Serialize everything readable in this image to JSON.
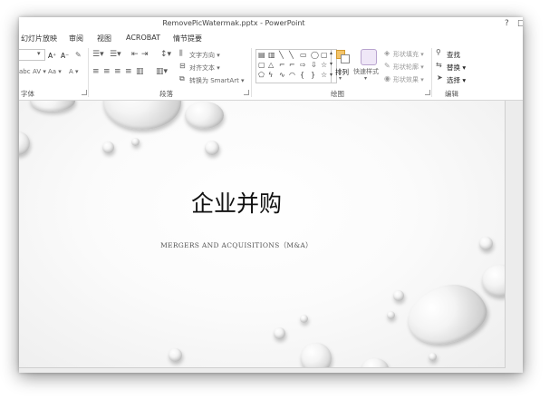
{
  "window": {
    "title": "RemovePicWatermak.pptx - PowerPoint",
    "help_label": "?",
    "restore_label": "□"
  },
  "tabs": [
    "幻灯片放映",
    "审阅",
    "视图",
    "ACROBAT",
    "情节提要"
  ],
  "ribbon": {
    "font": {
      "label": "字体",
      "grow_label": "A⁺",
      "shrink_label": "A⁻",
      "clear_label": "✎",
      "abc_label": "abc",
      "spacing_label": "AV ▾",
      "case_label": "Aa ▾",
      "color_label": "A ▾"
    },
    "paragraph": {
      "label": "段落",
      "text_direction_label": "文字方向 ▾",
      "align_text_label": "对齐文本 ▾",
      "smartart_label": "转换为 SmartArt ▾"
    },
    "drawing": {
      "label": "绘图",
      "arrange_label": "排列",
      "quick_styles_label": "快速样式",
      "shape_fill_label": "形状填充 ▾",
      "shape_outline_label": "形状轮廓 ▾",
      "shape_effects_label": "形状效果 ▾"
    },
    "editing": {
      "label": "编辑",
      "find_label": "查找",
      "replace_label": "替换 ▾",
      "select_label": "选择 ▾"
    }
  },
  "slide": {
    "title": "企业并购",
    "subtitle": "MERGERS AND ACQUISITIONS（M&A）"
  },
  "colors": {
    "accent_arrange": "#e8a33a",
    "accent_quick_styles": "#a682c4"
  },
  "icons": {
    "find": "binoculars-icon",
    "replace": "replace-icon",
    "select": "cursor-icon"
  }
}
